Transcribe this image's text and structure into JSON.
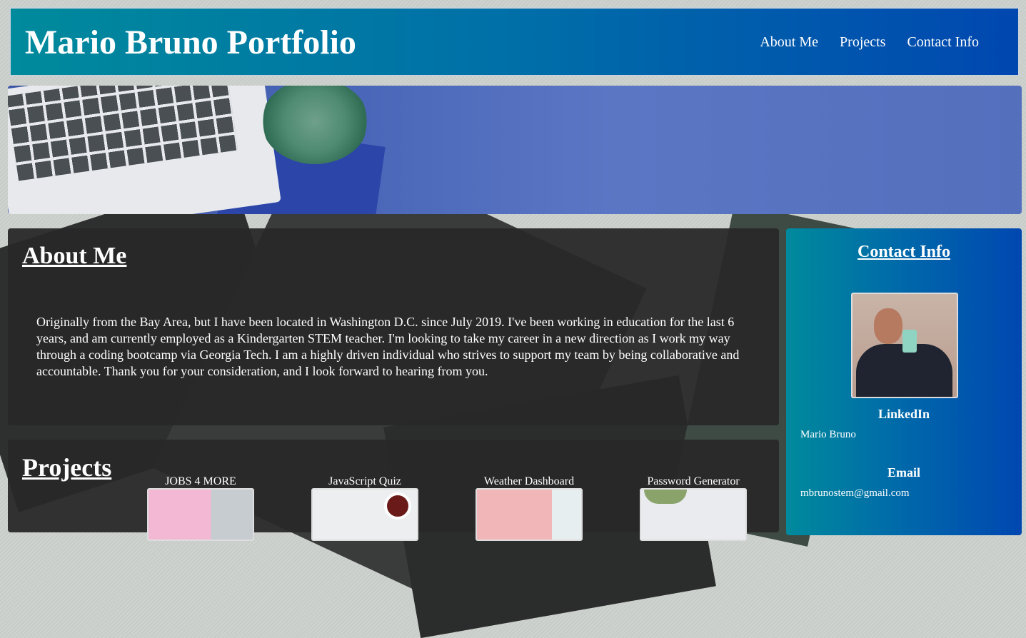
{
  "header": {
    "title": "Mario Bruno Portfolio",
    "nav": [
      "About Me",
      "Projects",
      "Contact Info"
    ]
  },
  "about": {
    "heading": "About Me",
    "text": "Originally from the Bay Area, but I have been located in Washington D.C. since July 2019. I've been working in education for the last 6 years, and am currently employed as a Kindergarten STEM teacher. I'm looking to take my career in a new direction as I work my way through a coding bootcamp via Georgia Tech. I am a highly driven individual who strives to support my team by being collaborative and accountable. Thank you for your consideration, and I look forward to hearing from you."
  },
  "projects": {
    "heading": "Projects",
    "items": [
      "JOBS 4 MORE",
      "JavaScript Quiz",
      "Weather Dashboard",
      "Password Generator"
    ]
  },
  "contact": {
    "heading": "Contact Info",
    "linkedin_label": "LinkedIn",
    "linkedin_value": "Mario Bruno",
    "email_label": "Email",
    "email_value": "mbrunostem@gmail.com"
  },
  "colors": {
    "header_gradient_start": "#008a9c",
    "header_gradient_end": "#0047b0",
    "panel_dark": "#2f2f2f"
  }
}
